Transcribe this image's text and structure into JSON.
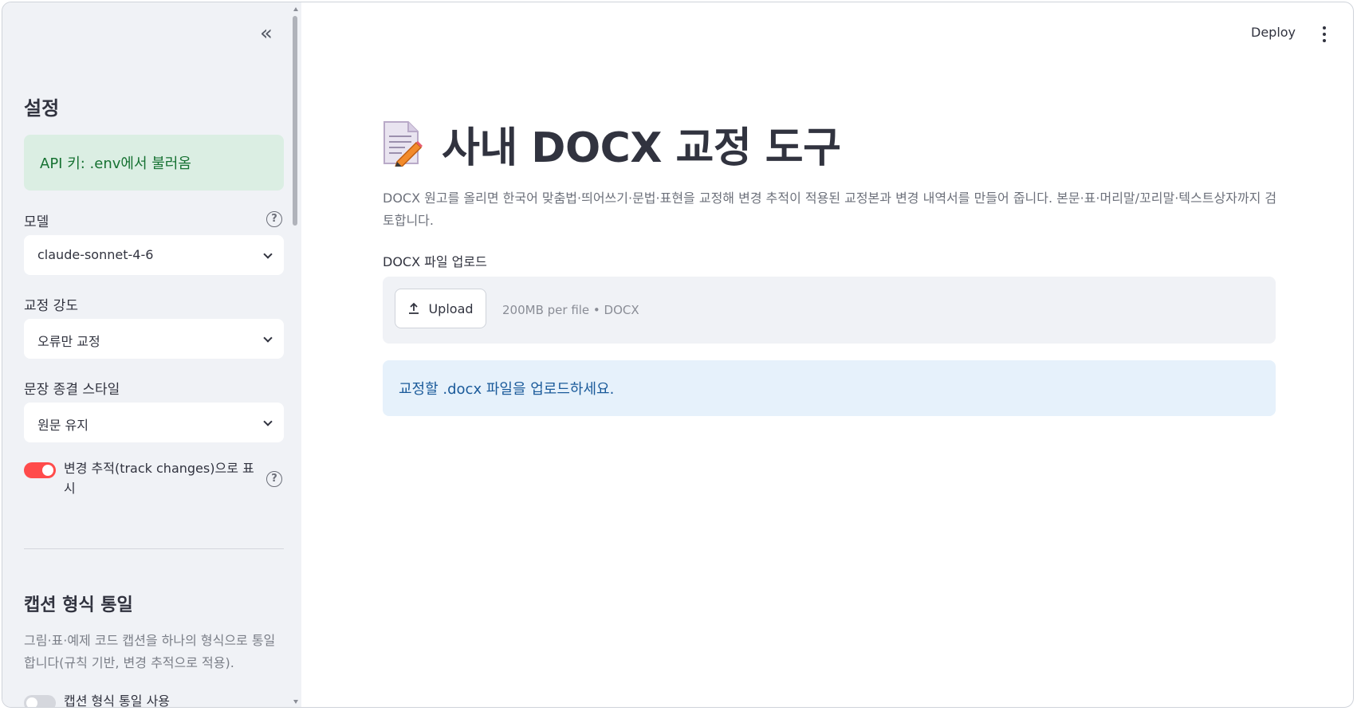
{
  "sidebar": {
    "title": "설정",
    "api_status": "API 키: .env에서 불러옴",
    "model_label": "모델",
    "model_value": "claude-sonnet-4-6",
    "intensity_label": "교정 강도",
    "intensity_value": "오류만 교정",
    "ending_label": "문장 종결 스타일",
    "ending_value": "원문 유지",
    "track_changes_label": "변경 추적(track changes)으로 표시",
    "track_changes_enabled": true,
    "caption_title": "캡션 형식 통일",
    "caption_desc": "그림·표·예제 코드 캡션을 하나의 형식으로 통일합니다(규칙 기반, 변경 추적으로 적용).",
    "caption_toggle_label": "캡션 형식 통일 사용",
    "caption_enabled": false
  },
  "header": {
    "deploy_label": "Deploy"
  },
  "main": {
    "title": "사내 DOCX 교정 도구",
    "subtitle": "DOCX 원고를 올리면 한국어 맞춤법·띄어쓰기·문법·표현을 교정해 변경 추적이 적용된 교정본과 변경 내역서를 만들어 줍니다. 본문·표·머리말/꼬리말·텍스트상자까지 검토합니다.",
    "upload_label": "DOCX 파일 업로드",
    "upload_button": "Upload",
    "upload_hint": "200MB per file • DOCX",
    "info_message": "교정할 .docx 파일을 업로드하세요."
  },
  "colors": {
    "accent": "#ff4b4b",
    "success_bg": "#dbeee3",
    "info_bg": "#e6f1fb"
  }
}
